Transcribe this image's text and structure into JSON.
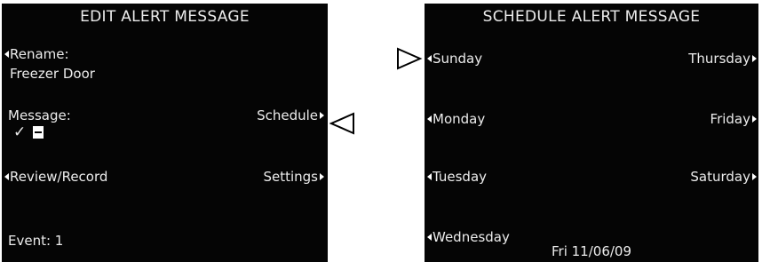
{
  "edit_screen": {
    "title": "EDIT ALERT MESSAGE",
    "rename_label": "Rename:",
    "rename_value": "Freezer Door",
    "message_label": "Message:",
    "schedule_label": "Schedule",
    "review_record_label": "Review/Record",
    "settings_label": "Settings",
    "event_label": "Event: 1"
  },
  "schedule_screen": {
    "title": "SCHEDULE ALERT MESSAGE",
    "days_left": [
      "Sunday",
      "Monday",
      "Tuesday",
      "Wednesday"
    ],
    "days_right": [
      "Thursday",
      "Friday",
      "Saturday"
    ],
    "date": "Fri 11/06/09"
  },
  "icons": {
    "check": "check-icon",
    "message_box": "message-minus-icon",
    "left_pointer": "pointer-left-icon",
    "right_pointer": "pointer-right-icon"
  },
  "colors": {
    "screen_bg": "#050505",
    "text": "#ececec",
    "page_bg": "#ffffff"
  }
}
